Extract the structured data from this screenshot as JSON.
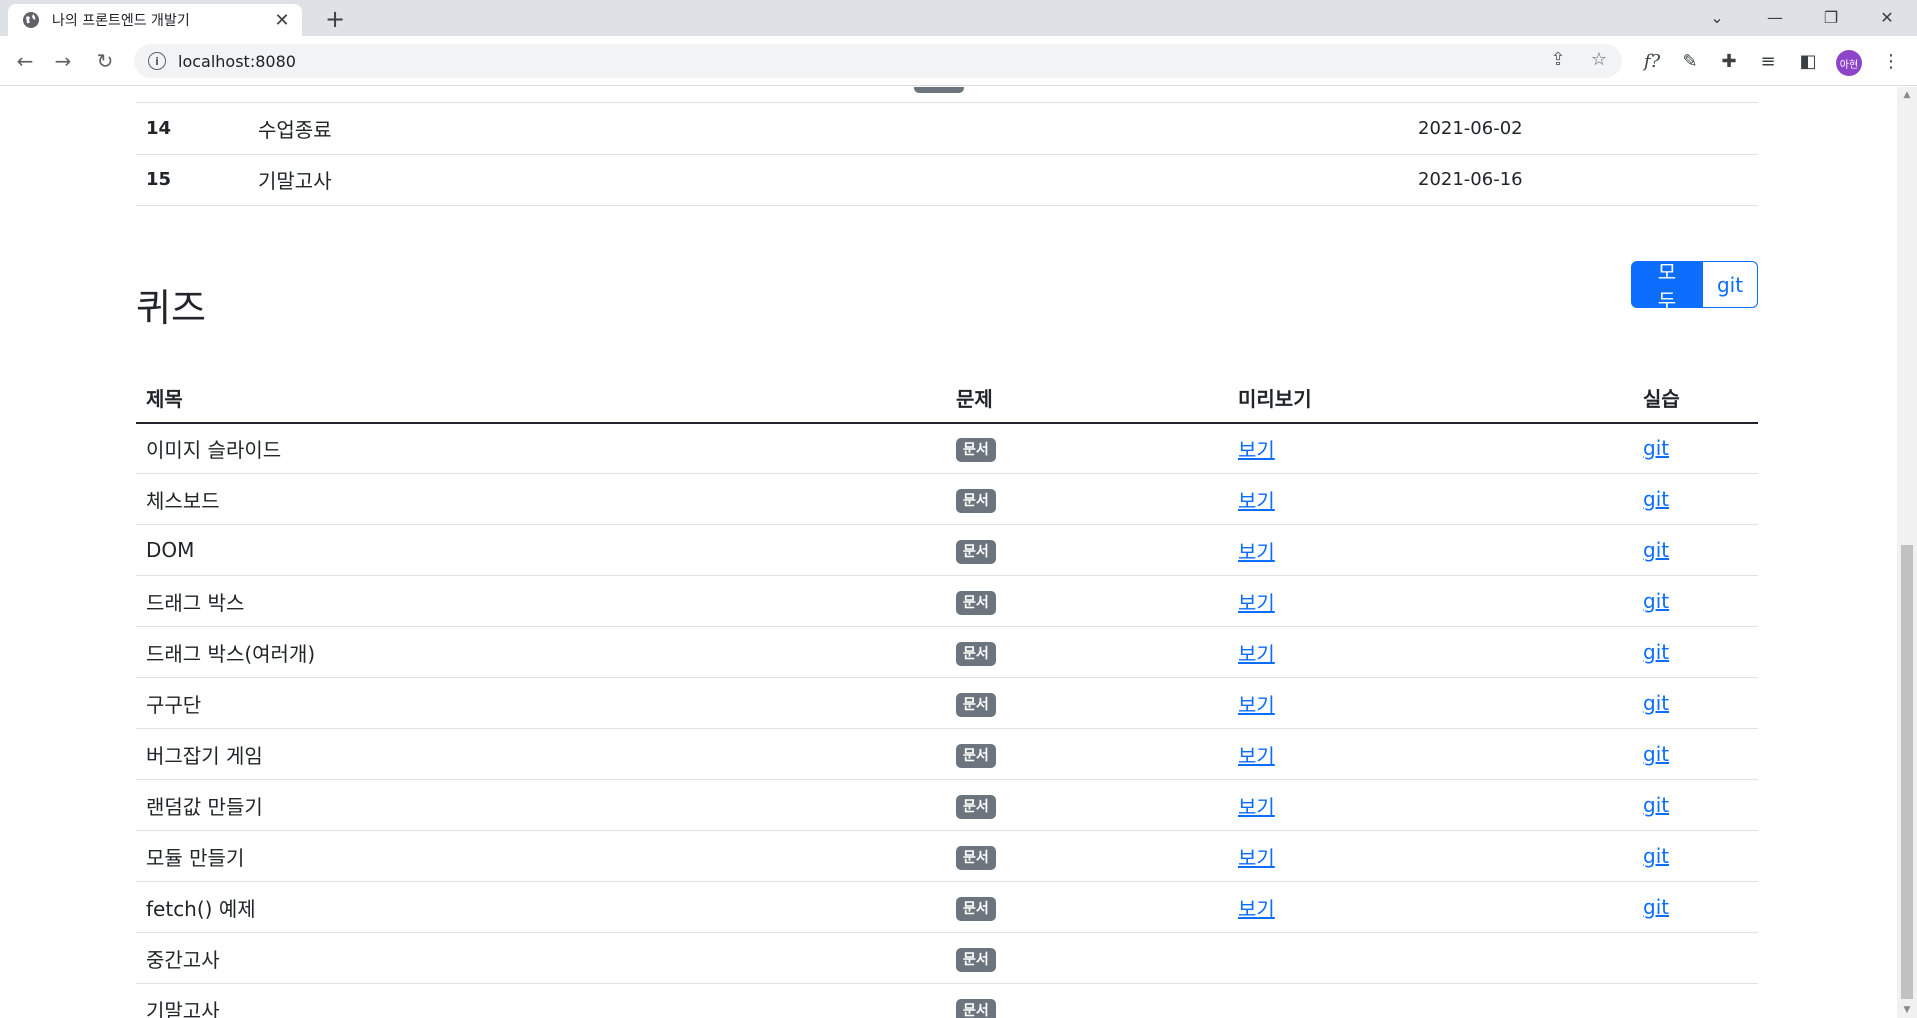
{
  "browser": {
    "tab_title": "나의 프론트엔드 개발기",
    "url": "localhost:8080",
    "avatar_text": "아현"
  },
  "schedule": {
    "rows": [
      {
        "num": "14",
        "title": "수업종료",
        "date": "2021-06-02"
      },
      {
        "num": "15",
        "title": "기말고사",
        "date": "2021-06-16"
      }
    ]
  },
  "quiz": {
    "title": "퀴즈",
    "filter": {
      "all_label": "모두",
      "git_label": "git"
    },
    "headers": {
      "title": "제목",
      "problem": "문제",
      "preview": "미리보기",
      "practice": "실습"
    },
    "rows": [
      {
        "title": "이미지 슬라이드",
        "badge": "문서",
        "preview": "보기",
        "git": "git"
      },
      {
        "title": "체스보드",
        "badge": "문서",
        "preview": "보기",
        "git": "git"
      },
      {
        "title": "DOM",
        "badge": "문서",
        "preview": "보기",
        "git": "git"
      },
      {
        "title": "드래그 박스",
        "badge": "문서",
        "preview": "보기",
        "git": "git"
      },
      {
        "title": "드래그 박스(여러개)",
        "badge": "문서",
        "preview": "보기",
        "git": "git"
      },
      {
        "title": "구구단",
        "badge": "문서",
        "preview": "보기",
        "git": "git"
      },
      {
        "title": "버그잡기 게임",
        "badge": "문서",
        "preview": "보기",
        "git": "git"
      },
      {
        "title": "랜덤값 만들기",
        "badge": "문서",
        "preview": "보기",
        "git": "git"
      },
      {
        "title": "모듈 만들기",
        "badge": "문서",
        "preview": "보기",
        "git": "git"
      },
      {
        "title": "fetch() 예제",
        "badge": "문서",
        "preview": "보기",
        "git": "git"
      },
      {
        "title": "중간고사",
        "badge": "문서",
        "preview": "",
        "git": ""
      },
      {
        "title": "기말고사",
        "badge": "문서",
        "preview": "",
        "git": ""
      }
    ]
  },
  "colors": {
    "primary": "#0d6efd",
    "badge": "#6c757d",
    "text": "#212529"
  }
}
